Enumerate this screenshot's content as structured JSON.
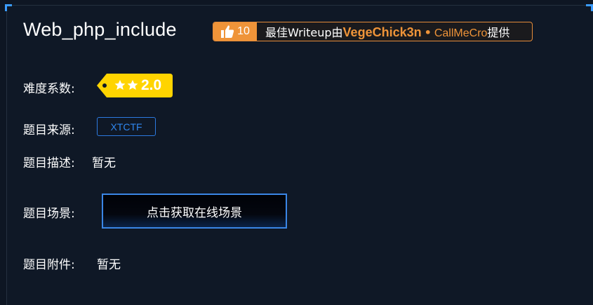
{
  "challenge": {
    "title": "Web_php_include"
  },
  "writeup_badge": {
    "like_icon": "thumbs-up-icon",
    "like_count": "10",
    "prefix": "最佳Writeup由",
    "author_primary": "VegeChick3n",
    "separator": "•",
    "author_secondary": "CallMeCro",
    "suffix": "提供",
    "accent_color": "#ef9439"
  },
  "difficulty": {
    "label": "难度系数:",
    "stars_icon": "two-stars-icon",
    "value": "2.0",
    "tag_color": "#ffd400"
  },
  "source": {
    "label": "题目来源:",
    "value": "XTCTF",
    "color": "#2f86ee"
  },
  "description": {
    "label": "题目描述:",
    "value": "暂无"
  },
  "scene": {
    "label": "题目场景:",
    "button_label": "点击获取在线场景"
  },
  "attachment": {
    "label": "题目附件:",
    "value": "暂无"
  }
}
